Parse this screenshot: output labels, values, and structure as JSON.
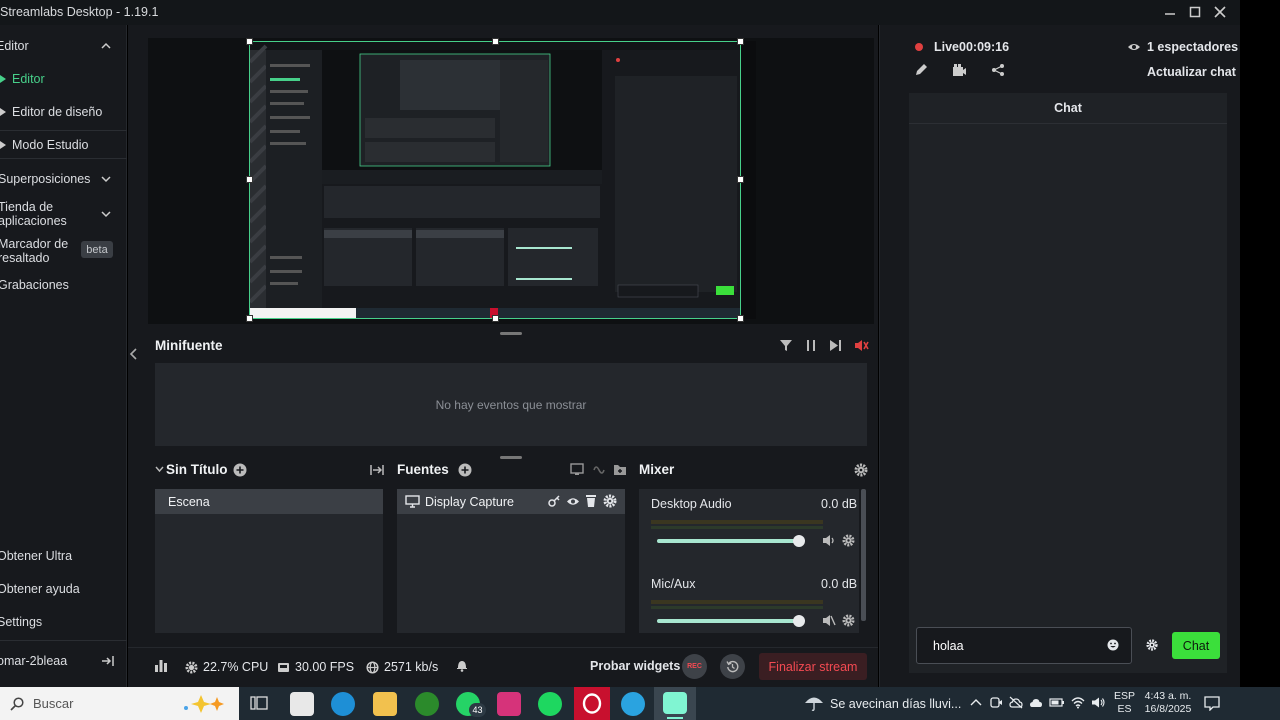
{
  "window": {
    "title": "Streamlabs Desktop - 1.19.1"
  },
  "sidebar": {
    "items": [
      {
        "label": "Editor"
      },
      {
        "label": "Editor"
      },
      {
        "label": "Editor de diseño"
      },
      {
        "label": "Modo Estudio"
      },
      {
        "label": "Superposiciones"
      },
      {
        "label_line1": "Tienda de",
        "label_line2": "aplicaciones"
      },
      {
        "label_line1": "Marcador de",
        "label_line2": "resaltado",
        "badge": "beta"
      },
      {
        "label": "Grabaciones"
      }
    ],
    "bottom_items": [
      {
        "label": "Obtener Ultra"
      },
      {
        "label": "Obtener ayuda"
      },
      {
        "label": "Settings"
      },
      {
        "label": "omar-2bleaa"
      }
    ]
  },
  "minifuente": {
    "title": "Minifuente",
    "empty_text": "No hay eventos que mostrar"
  },
  "scenes": {
    "title": "Sin Título",
    "items": [
      "Escena"
    ]
  },
  "sources": {
    "title": "Fuentes",
    "items": [
      "Display Capture"
    ]
  },
  "mixer": {
    "title": "Mixer",
    "channels": [
      {
        "name": "Desktop Audio",
        "level": "0.0 dB",
        "volume": 1.0
      },
      {
        "name": "Mic/Aux",
        "level": "0.0 dB",
        "volume": 1.0
      }
    ]
  },
  "footer": {
    "cpu": "22.7% CPU",
    "fps": "30.00 FPS",
    "bitrate": "2571 kb/s",
    "test_widgets": "Probar widgets",
    "rec": "REC",
    "end_stream": "Finalizar stream"
  },
  "live": {
    "status": "Live",
    "time": "00:09:16",
    "viewers": "1 espectadores",
    "refresh_chat": "Actualizar chat"
  },
  "chat": {
    "title": "Chat",
    "input_value": "holaa",
    "send_label": "Chat"
  },
  "taskbar": {
    "search_placeholder": "Buscar",
    "whatsapp_badge": "43",
    "weather": "Se avecinan días lluvi...",
    "lang_line1": "ESP",
    "lang_line2": "ES",
    "time": "4:43 a. m.",
    "date": "16/8/2025"
  },
  "colors": {
    "accent": "#47d08a",
    "live_red": "#e04040",
    "chat_green": "#3bdf3b",
    "end_stream_red": "#f44a52"
  }
}
